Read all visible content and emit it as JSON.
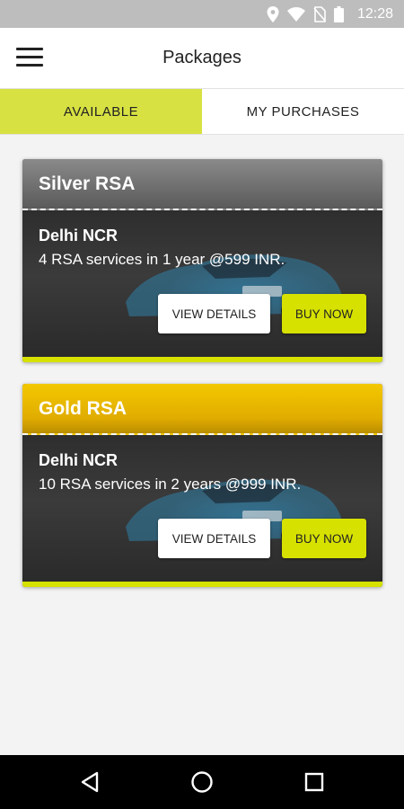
{
  "status_bar": {
    "time": "12:28",
    "icons": [
      "location-icon",
      "wifi-icon",
      "no-sim-icon",
      "battery-icon"
    ]
  },
  "app_bar": {
    "title": "Packages",
    "menu_icon": "hamburger-menu-icon"
  },
  "tabs": [
    {
      "label": "AVAILABLE",
      "active": true
    },
    {
      "label": "MY PURCHASES",
      "active": false
    }
  ],
  "packages": [
    {
      "name": "Silver RSA",
      "location": "Delhi NCR",
      "description": "4 RSA services in 1 year @599 INR.",
      "view_label": "VIEW DETAILS",
      "buy_label": "BUY NOW"
    },
    {
      "name": "Gold RSA",
      "location": "Delhi NCR",
      "description": "10 RSA services in 2 years @999 INR.",
      "view_label": "VIEW DETAILS",
      "buy_label": "BUY NOW"
    }
  ],
  "nav_bar": {
    "icons": [
      "back-icon",
      "home-icon",
      "recents-icon"
    ]
  },
  "colors": {
    "accent": "#d7e100",
    "silver": "#6e6e6e",
    "gold": "#f0c000"
  }
}
